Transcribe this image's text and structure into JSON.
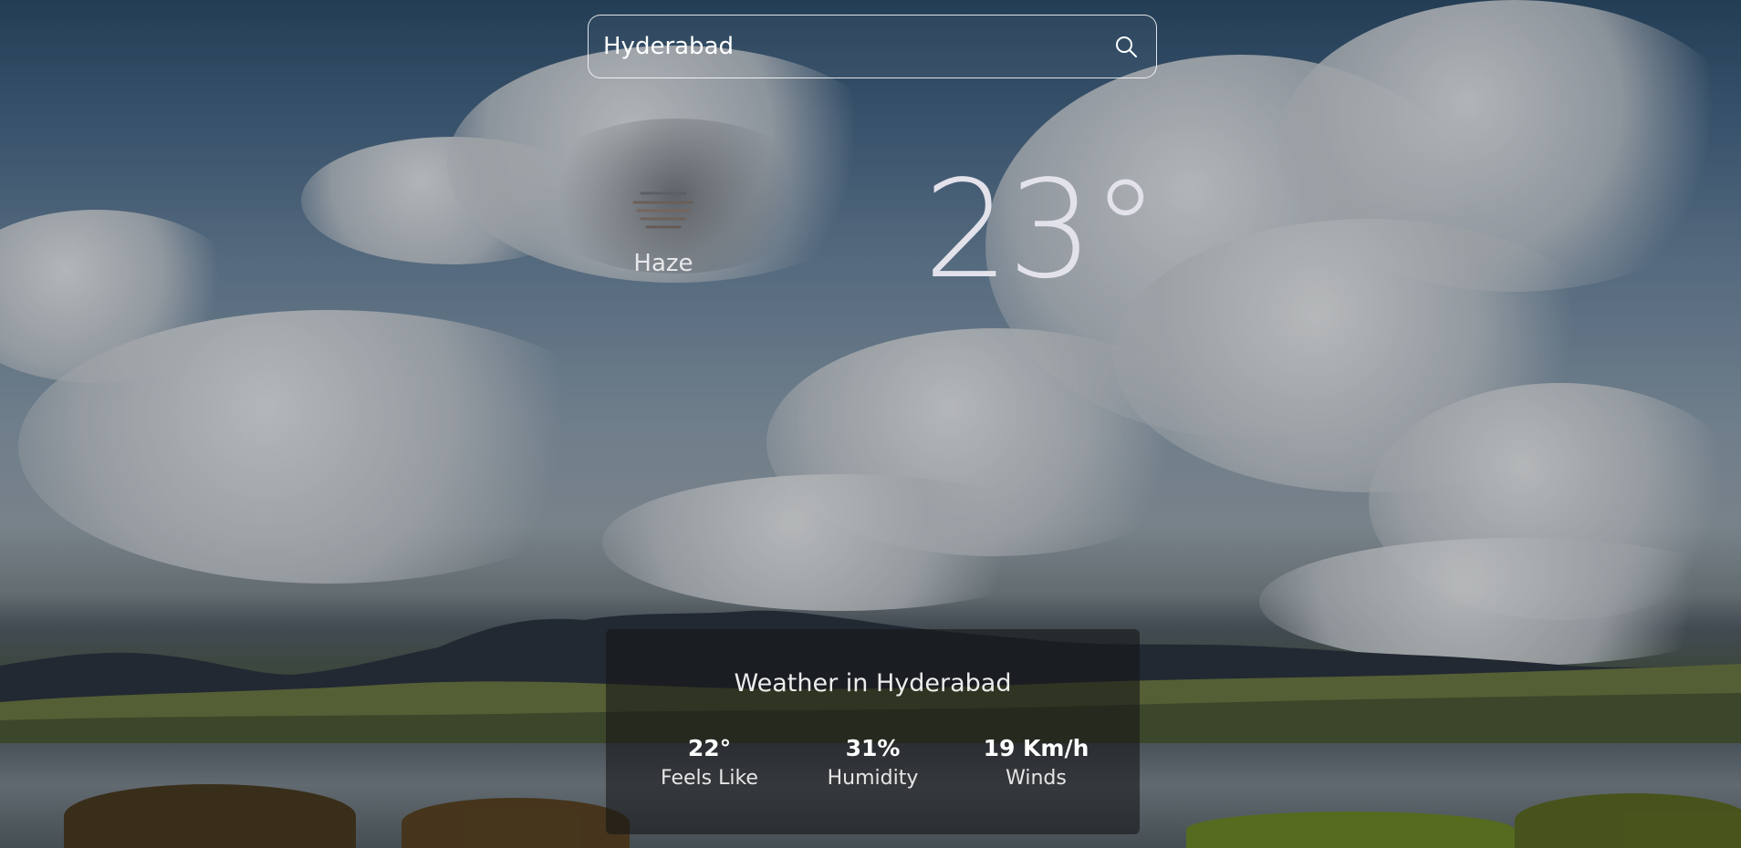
{
  "search": {
    "value": "Hyderabad",
    "icon": "search-icon"
  },
  "current": {
    "condition": "Haze",
    "condition_icon": "haze-icon",
    "temperature": "23°"
  },
  "details": {
    "title": "Weather in Hyderabad",
    "feels_like_value": "22°",
    "feels_like_label": "Feels Like",
    "humidity_value": "31%",
    "humidity_label": "Humidity",
    "winds_value": "19 Km/h",
    "winds_label": "Winds"
  }
}
